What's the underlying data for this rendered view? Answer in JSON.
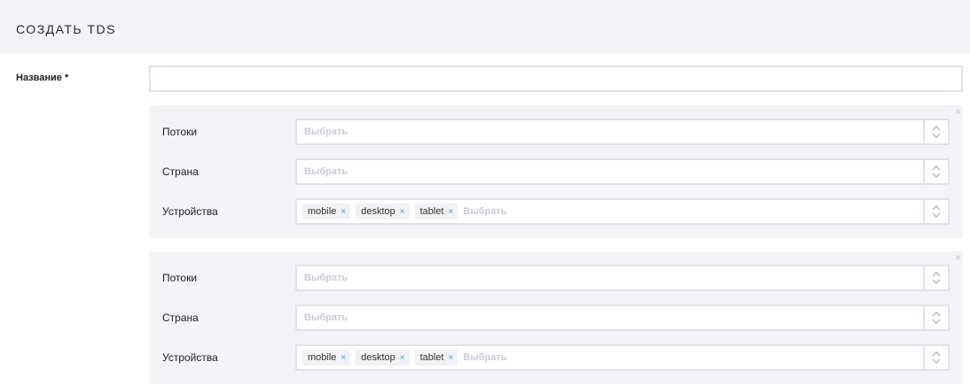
{
  "header": {
    "title": "СОЗДАТЬ TDS"
  },
  "form": {
    "name_label": "Название *",
    "name_value": "",
    "close_symbol": "×",
    "rules": [
      {
        "rows": [
          {
            "label": "Потоки",
            "placeholder": "Выбрать",
            "tags": []
          },
          {
            "label": "Страна",
            "placeholder": "Выбрать",
            "tags": []
          },
          {
            "label": "Устройства",
            "placeholder": "Выбрать",
            "tags": [
              "mobile",
              "desktop",
              "tablet"
            ]
          }
        ]
      },
      {
        "rows": [
          {
            "label": "Потоки",
            "placeholder": "Выбрать",
            "tags": []
          },
          {
            "label": "Страна",
            "placeholder": "Выбрать",
            "tags": []
          },
          {
            "label": "Устройства",
            "placeholder": "Выбрать",
            "tags": [
              "mobile",
              "desktop",
              "tablet"
            ]
          }
        ]
      }
    ]
  },
  "icons": {
    "remove_rule": "close-icon",
    "select_toggle": "chevron-up-down-icon",
    "tag_remove": "close-icon"
  },
  "colors": {
    "header_bg": "#f3f4f8",
    "block_bg": "#f3f4f8",
    "border": "#e1e3ea",
    "tag_x": "#4a9ad6",
    "placeholder": "#c9ccd6"
  }
}
